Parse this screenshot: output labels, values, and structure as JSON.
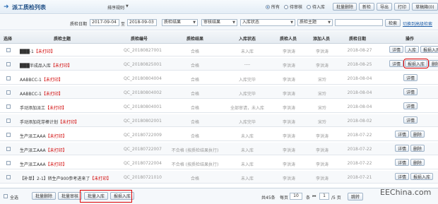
{
  "header": {
    "title": "派工质检列表",
    "sort_label": "排序规则",
    "radios": [
      {
        "label": "所有",
        "checked": true
      },
      {
        "label": "待审核",
        "checked": false
      },
      {
        "label": "待入库",
        "checked": false
      }
    ],
    "buttons": [
      "批量删除",
      "新检",
      "导出",
      "打印",
      "草稿箱(0)"
    ]
  },
  "filters": {
    "date_label": "质检日期",
    "date_from": "2017-09-04",
    "date_to_label": "至",
    "date_to": "2018-09-03",
    "result_select": "质检结果",
    "audit_select": "审核结果",
    "stock_select": "入库状态",
    "subject_select": "质检主题",
    "search_button": "检索",
    "advanced_link": "切换到高级检索"
  },
  "table": {
    "headers": [
      "选择",
      "质检主题",
      "质检编号",
      "质检结果",
      "入库状态",
      "质检人员",
      "添加人员",
      "质检日期",
      "操作"
    ],
    "rows": [
      {
        "subject_pre": "███-1",
        "subject_tag": "【未打印】",
        "code": "QC_20180827001",
        "result": "合格",
        "stock": "未入库",
        "inspector": "李洪涛",
        "adder": "李洪涛",
        "date": "2018-08-27",
        "ops": [
          "详情",
          "入库",
          "报损入库"
        ],
        "hl": []
      },
      {
        "subject_pre": "███半成品入库",
        "subject_tag": "【未打印】",
        "code": "QC_20180825001",
        "result": "合格",
        "stock": "----",
        "inspector": "李洪涛",
        "adder": "李洪涛",
        "date": "2018-08-25",
        "ops": [
          "详情",
          "报损入库",
          "删除"
        ],
        "hl": [
          "报损入库"
        ]
      },
      {
        "subject_pre": "AABBCC-1",
        "subject_tag": "【未打印】",
        "code": "QC_20180804004",
        "result": "合格",
        "stock": "入库完毕",
        "inspector": "李洪涛",
        "adder": "宋玲",
        "date": "2018-08-04",
        "ops": [
          "详情"
        ],
        "hl": []
      },
      {
        "subject_pre": "AABBCC-1",
        "subject_tag": "【未打印】",
        "code": "QC_20180804002",
        "result": "合格",
        "stock": "入库完毕",
        "inspector": "李洪涛",
        "adder": "宋玲",
        "date": "2018-08-04",
        "ops": [
          "详情"
        ],
        "hl": []
      },
      {
        "subject_pre": "手动添加派工",
        "subject_tag": "【未打印】",
        "code": "QC_20180804001",
        "result": "合格",
        "stock": "全部审请，未入库",
        "inspector": "李洪涛",
        "adder": "宋玲",
        "date": "2018-08-04",
        "ops": [
          "详情"
        ],
        "hl": []
      },
      {
        "subject_pre": "手动添加花芽棒计划",
        "subject_tag": "【未打印】",
        "code": "QC_20180802001",
        "result": "合格",
        "stock": "入库完毕",
        "inspector": "李洪涛",
        "adder": "宋玲",
        "date": "2018-08-02",
        "ops": [
          "详情"
        ],
        "hl": []
      },
      {
        "subject_pre": "生产派工AAA",
        "subject_tag": "【未打印】",
        "code": "QC_20180722009",
        "result": "合格",
        "stock": "未入库",
        "inspector": "李洪涛",
        "adder": "李洪涛",
        "date": "2018-07-22",
        "ops": [
          "详情",
          "删除"
        ],
        "hl": []
      },
      {
        "subject_pre": "生产派工AAA",
        "subject_tag": "【未打印】",
        "code": "QC_20180722007",
        "result": "不合格 (按质检结果执行)",
        "stock": "未入库",
        "inspector": "李洪涛",
        "adder": "李洪涛",
        "date": "2018-07-22",
        "ops": [
          "详情",
          "删除"
        ],
        "hl": []
      },
      {
        "subject_pre": "生产派工AAA",
        "subject_tag": "【未打印】",
        "code": "QC_20180722004",
        "result": "不合格 (按质检结果执行)",
        "stock": "未入库",
        "inspector": "李洪涛",
        "adder": "李洪涛",
        "date": "2018-07-22",
        "ops": [
          "详情",
          "删除"
        ],
        "hl": []
      },
      {
        "subject_pre": "【补单】2-1】转生产900参考进来了",
        "subject_tag": "【未打印】",
        "code": "QC_20180721010",
        "result": "合格",
        "stock": "未入库",
        "inspector": "李洪涛",
        "adder": "李洪涛",
        "date": "2018-07-21",
        "ops": [
          "详情",
          "报损入库"
        ],
        "hl": []
      }
    ]
  },
  "footer": {
    "select_all": "全选",
    "buttons": [
      "批量删除",
      "批量审核",
      "批量入库",
      "报损入库"
    ],
    "total": "共45条",
    "per_page_label": "每页",
    "per_page": "10",
    "per_page_unit": "条",
    "page_current": "1",
    "page_total": "/5 页",
    "jump": "跳转",
    "watermark": "EEChina.com"
  }
}
